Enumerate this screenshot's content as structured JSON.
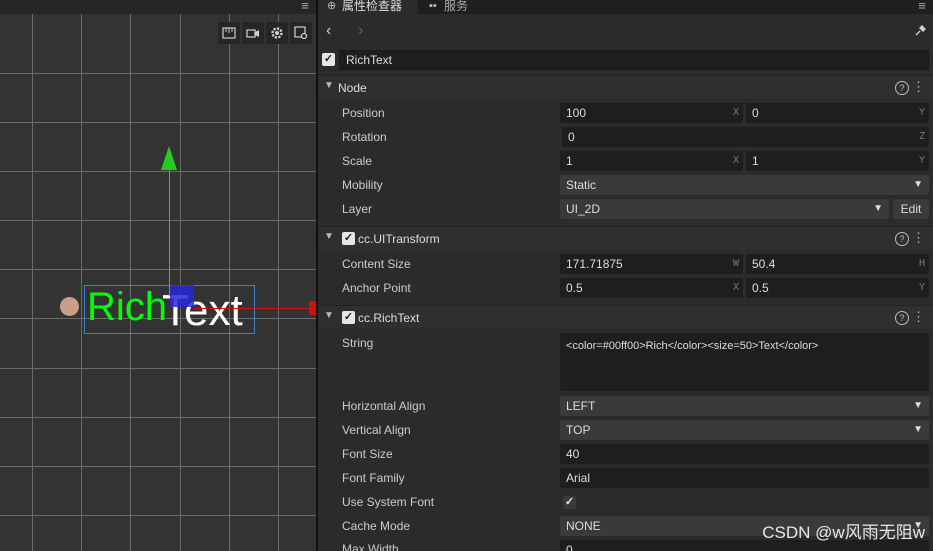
{
  "scene": {
    "tools": [
      "ruler-icon",
      "camera-icon",
      "gear-icon",
      "view-icon"
    ],
    "rich_green": "Rich",
    "rich_white": "Text"
  },
  "inspector": {
    "tabs": [
      {
        "label": "属性检查器",
        "icon": "inspector-icon"
      },
      {
        "label": "服务",
        "icon": "services-icon"
      }
    ],
    "node_name": "RichText",
    "node_enabled": true
  },
  "node_section": {
    "title": "Node",
    "position_label": "Position",
    "position_x": "100",
    "position_y": "0",
    "rotation_label": "Rotation",
    "rotation_z": "0",
    "scale_label": "Scale",
    "scale_x": "1",
    "scale_y": "1",
    "mobility_label": "Mobility",
    "mobility_value": "Static",
    "layer_label": "Layer",
    "layer_value": "UI_2D",
    "layer_edit": "Edit"
  },
  "uitransform_section": {
    "title": "cc.UITransform",
    "content_size_label": "Content Size",
    "width": "171.71875",
    "height": "50.4",
    "anchor_label": "Anchor Point",
    "anchor_x": "0.5",
    "anchor_y": "0.5"
  },
  "richtext_section": {
    "title": "cc.RichText",
    "string_label": "String",
    "string_value": "<color=#00ff00>Rich</color><size=50>Text</color>",
    "h_align_label": "Horizontal Align",
    "h_align_value": "LEFT",
    "v_align_label": "Vertical Align",
    "v_align_value": "TOP",
    "font_size_label": "Font Size",
    "font_size_value": "40",
    "font_family_label": "Font Family",
    "font_family_value": "Arial",
    "system_font_label": "Use System Font",
    "system_font_checked": true,
    "cache_mode_label": "Cache Mode",
    "cache_mode_value": "NONE",
    "max_width_label": "Max Width",
    "max_width_value": "0"
  },
  "axis_suffixes": {
    "x": "X",
    "y": "Y",
    "z": "Z",
    "w": "W",
    "h": "H"
  },
  "watermark": "CSDN @w风雨无阻w",
  "colors": {
    "rich_green": "#00ff00",
    "rich_white": "#ffffff",
    "y_axis": "#22cc22",
    "x_axis": "#d01010",
    "anchor": "#2828dc",
    "selection": "#3a86c8"
  }
}
